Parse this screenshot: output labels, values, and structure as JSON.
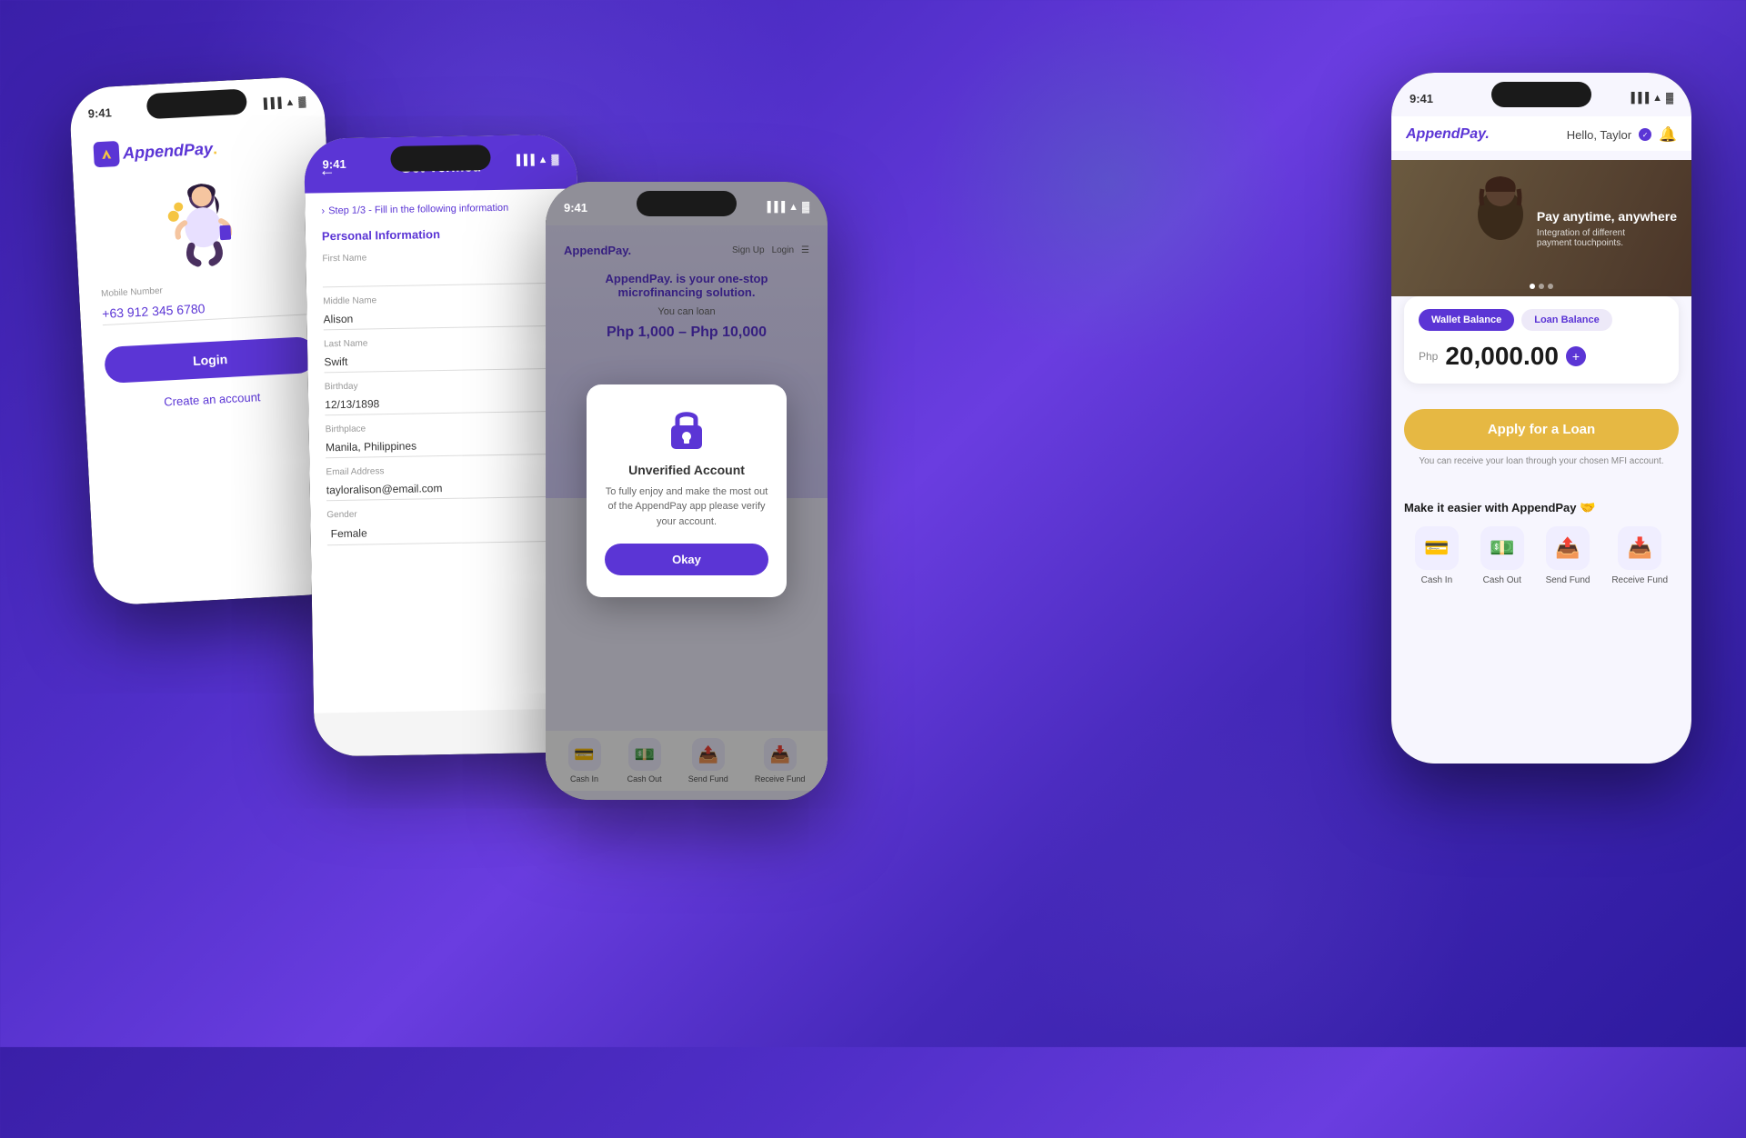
{
  "background": {
    "color1": "#3a1fa8",
    "color2": "#6a3de0"
  },
  "phone1_login": {
    "status_time": "9:41",
    "logo": "AppendPay.",
    "mobile_label": "Mobile Number",
    "mobile_value": "+63 912 345 6780",
    "login_btn": "Login",
    "create_account": "Create an account"
  },
  "phone2_verify": {
    "status_time": "9:41",
    "back_icon": "←",
    "title": "Get Verified",
    "step_text": "Step 1/3 - Fill in the following information",
    "section_title": "Personal Information",
    "fields": [
      {
        "label": "First Name",
        "value": "",
        "placeholder": ""
      },
      {
        "label": "Middle Name",
        "value": "Alison"
      },
      {
        "label": "Last Name",
        "value": "Swift"
      },
      {
        "label": "Birthday",
        "value": "12/13/1898"
      },
      {
        "label": "Birthplace",
        "value": "Manila, Philippines"
      },
      {
        "label": "Email Address",
        "value": "tayloralison@email.com"
      },
      {
        "label": "Gender",
        "value": "Female",
        "type": "select"
      }
    ]
  },
  "phone3_popup": {
    "status_time": "9:41",
    "app_logo": "AppendPay.",
    "nav_items": [
      "Sign Up",
      "Login"
    ],
    "hero_text": "AppendPay. is your one-stop microfinancing solution.",
    "you_can_loan": "You can loan",
    "amount_range": "Php 1,000 – Php 10,000",
    "modal_title": "Unverified Account",
    "modal_body": "To fully enjoy and make the most out of the AppendPay app please verify your account.",
    "modal_btn": "Okay",
    "actions": [
      {
        "label": "Cash In",
        "icon": "💳"
      },
      {
        "label": "Cash Out",
        "icon": "💵"
      },
      {
        "label": "Send Fund",
        "icon": "📤"
      },
      {
        "label": "Receive Fund",
        "icon": "📥"
      }
    ]
  },
  "phone4_main": {
    "status_time": "9:41",
    "logo": "AppendPay.",
    "greeting": "Hello, Taylor",
    "balance_tab1": "Wallet Balance",
    "balance_tab2": "Loan Balance",
    "currency": "Php",
    "balance_amount": "20,000.00",
    "banner_title": "Pay anytime, anywhere",
    "banner_subtitle": "Integration of different payment touchpoints.",
    "loan_btn": "Apply for a Loan",
    "loan_note": "You can receive your loan through your chosen MFI account.",
    "easier_title": "Make it easier with AppendPay",
    "easier_emoji": "🤝",
    "actions": [
      {
        "label": "Cash In",
        "icon": "💳"
      },
      {
        "label": "Cash Out",
        "icon": "💵"
      },
      {
        "label": "Send Fund",
        "icon": "📤"
      },
      {
        "label": "Receive Fund",
        "icon": "📥"
      }
    ]
  }
}
